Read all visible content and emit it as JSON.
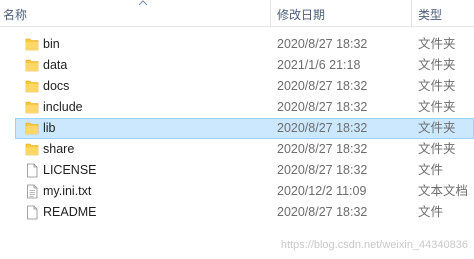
{
  "header": {
    "name": "名称",
    "date": "修改日期",
    "type": "类型"
  },
  "items": [
    {
      "name": "bin",
      "date": "2020/8/27 18:32",
      "type": "文件夹",
      "icon": "folder-icon"
    },
    {
      "name": "data",
      "date": "2021/1/6 21:18",
      "type": "文件夹",
      "icon": "folder-icon"
    },
    {
      "name": "docs",
      "date": "2020/8/27 18:32",
      "type": "文件夹",
      "icon": "folder-icon"
    },
    {
      "name": "include",
      "date": "2020/8/27 18:32",
      "type": "文件夹",
      "icon": "folder-icon"
    },
    {
      "name": "lib",
      "date": "2020/8/27 18:32",
      "type": "文件夹",
      "icon": "folder-icon",
      "selected": true
    },
    {
      "name": "share",
      "date": "2020/8/27 18:32",
      "type": "文件夹",
      "icon": "folder-icon"
    },
    {
      "name": "LICENSE",
      "date": "2020/8/27 18:32",
      "type": "文件",
      "icon": "file-icon"
    },
    {
      "name": "my.ini.txt",
      "date": "2020/12/2 11:09",
      "type": "文本文档",
      "icon": "text-file-icon"
    },
    {
      "name": "README",
      "date": "2020/8/27 18:32",
      "type": "文件",
      "icon": "file-icon"
    }
  ],
  "watermark": "https://blog.csdn.net/weixin_44340836",
  "colors": {
    "folder": "#ffc93c",
    "selection_bg": "#cce8ff",
    "selection_border": "#99d1ff",
    "header_text": "#4c607a"
  }
}
